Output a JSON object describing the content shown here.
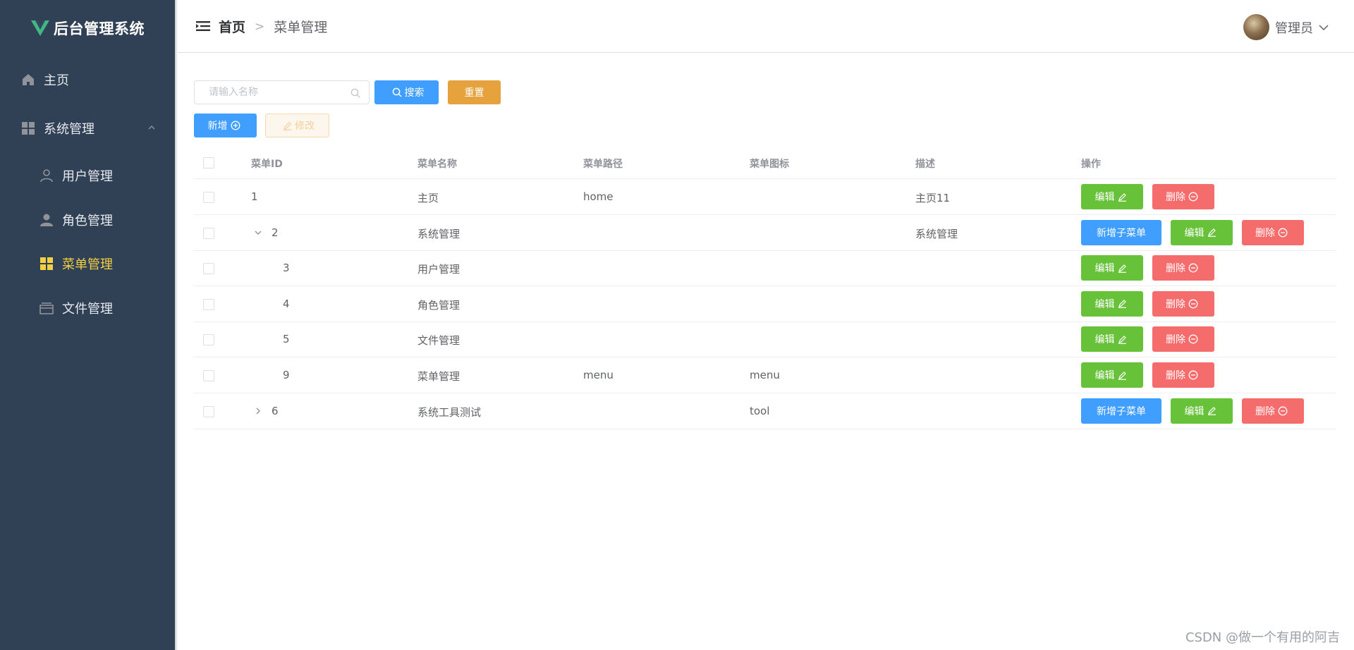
{
  "app": {
    "title": "后台管理系统"
  },
  "sidebar": {
    "items": [
      {
        "label": "主页",
        "icon": "home-icon"
      },
      {
        "label": "系统管理",
        "icon": "grid-icon",
        "expanded": true
      },
      {
        "label": "用户管理",
        "icon": "user-icon"
      },
      {
        "label": "角色管理",
        "icon": "person-icon"
      },
      {
        "label": "菜单管理",
        "icon": "menu-grid-icon",
        "active": true
      },
      {
        "label": "文件管理",
        "icon": "box-icon"
      }
    ],
    "active_color": "#f3cf45",
    "background": "#304156"
  },
  "header": {
    "breadcrumb": {
      "home": "首页",
      "separator": ">",
      "current": "菜单管理"
    },
    "user": {
      "name": "管理员"
    }
  },
  "toolbar": {
    "search_placeholder": "请输入名称",
    "search_label": "搜索",
    "reset_label": "重置",
    "add_label": "新增",
    "edit_label": "修改"
  },
  "table": {
    "columns": [
      "菜单ID",
      "菜单名称",
      "菜单路径",
      "菜单图标",
      "描述",
      "操作"
    ],
    "action_labels": {
      "add_child": "新增子菜单",
      "edit": "编辑",
      "delete": "删除"
    },
    "rows": [
      {
        "id": "1",
        "name": "主页",
        "path": "home",
        "icon": "",
        "desc": "主页11",
        "level": 0,
        "expand": "none",
        "add_child": false
      },
      {
        "id": "2",
        "name": "系统管理",
        "path": "",
        "icon": "",
        "desc": "系统管理",
        "level": 0,
        "expand": "down",
        "add_child": true
      },
      {
        "id": "3",
        "name": "用户管理",
        "path": "",
        "icon": "",
        "desc": "",
        "level": 1,
        "expand": "none",
        "add_child": false
      },
      {
        "id": "4",
        "name": "角色管理",
        "path": "",
        "icon": "",
        "desc": "",
        "level": 1,
        "expand": "none",
        "add_child": false
      },
      {
        "id": "5",
        "name": "文件管理",
        "path": "",
        "icon": "",
        "desc": "",
        "level": 1,
        "expand": "none",
        "add_child": false
      },
      {
        "id": "9",
        "name": "菜单管理",
        "path": "menu",
        "icon": "menu",
        "desc": "",
        "level": 1,
        "expand": "none",
        "add_child": false
      },
      {
        "id": "6",
        "name": "系统工具测试",
        "path": "",
        "icon": "tool",
        "desc": "",
        "level": 0,
        "expand": "right",
        "add_child": true
      }
    ]
  },
  "watermark": "CSDN @做一个有用的阿吉",
  "colors": {
    "primary": "#409eff",
    "success": "#67c23a",
    "danger": "#f56c6c",
    "warning": "#e6a23c"
  }
}
